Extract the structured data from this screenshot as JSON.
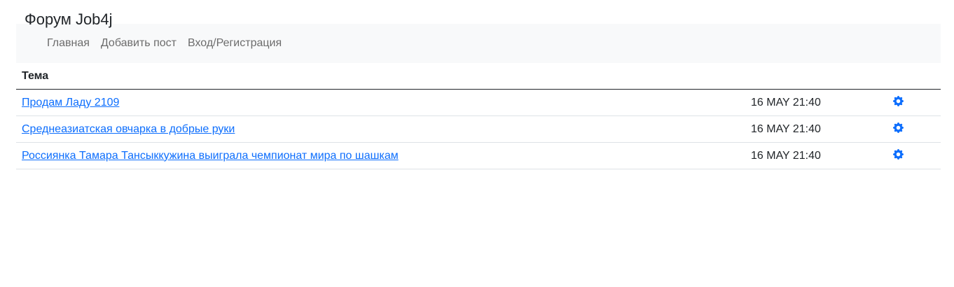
{
  "header": {
    "title": "Форум Job4j"
  },
  "nav": {
    "items": [
      {
        "label": "Главная"
      },
      {
        "label": "Добавить пост"
      },
      {
        "label": "Вход/Регистрация"
      }
    ]
  },
  "table": {
    "header_topic": "Тема",
    "rows": [
      {
        "topic": "Продам Ладу 2109",
        "date": "16 MAY 21:40",
        "action_icon": "gear-icon"
      },
      {
        "topic": "Среднеазиатская овчарка в добрые руки",
        "date": "16 MAY 21:40",
        "action_icon": "gear-icon"
      },
      {
        "topic": "Россиянка Тамара Тансыккужина выиграла чемпионат мира по шашкам",
        "date": "16 MAY 21:40",
        "action_icon": "gear-icon"
      }
    ]
  },
  "colors": {
    "link": "#0d6efd",
    "navbar_bg": "#f8f9fa",
    "icon": "#0d6efd"
  }
}
